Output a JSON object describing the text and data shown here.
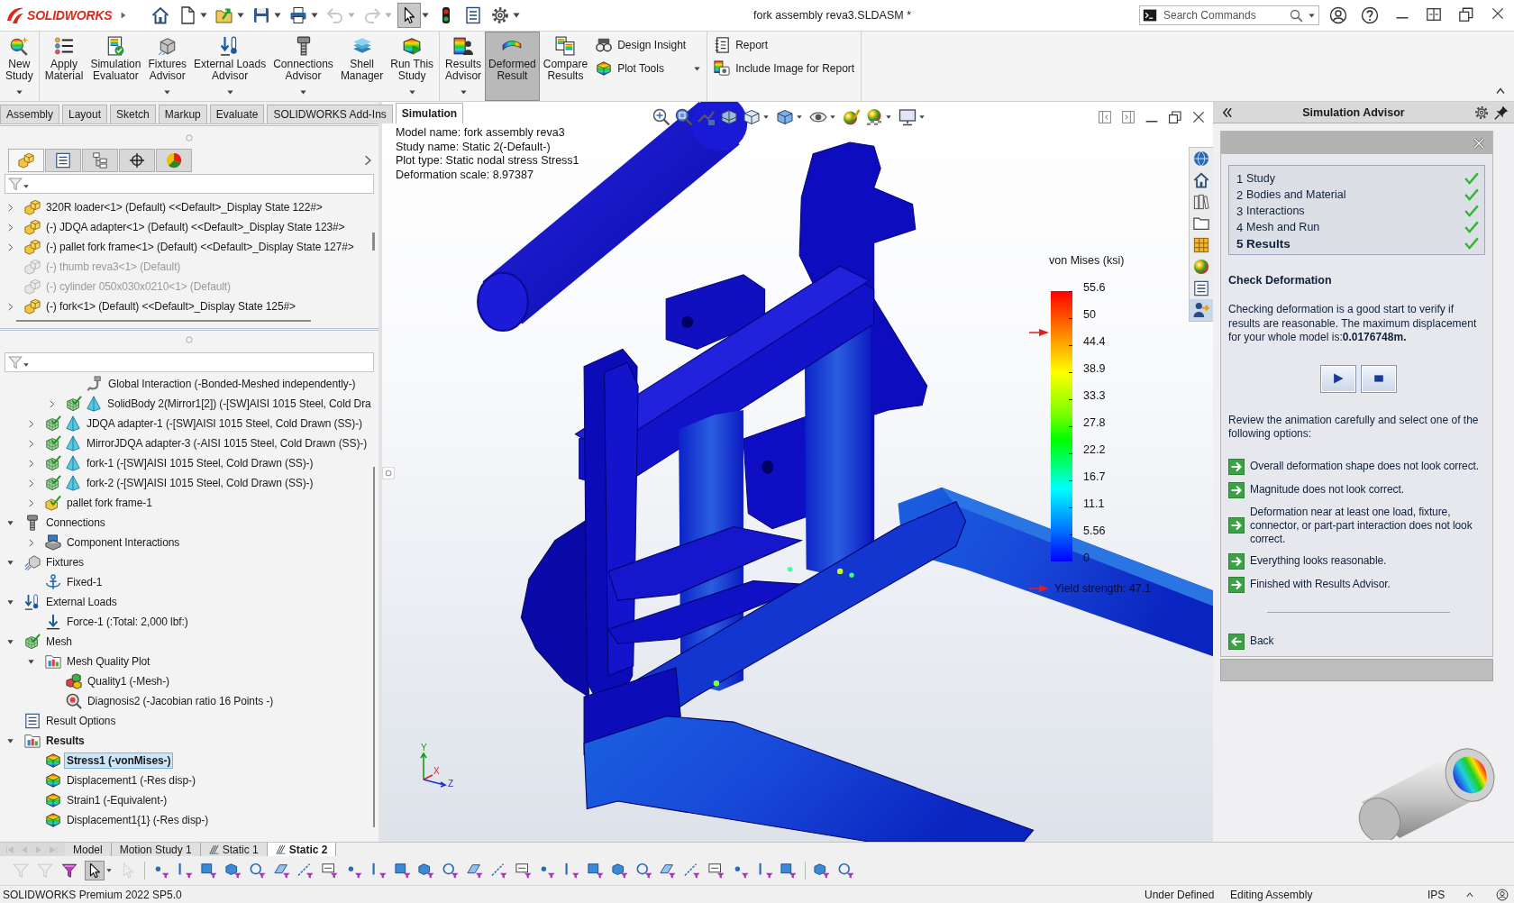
{
  "title_bar": {
    "logo": "SOLIDWORKS",
    "document_title": "fork assembly reva3.SLDASM *",
    "search": {
      "placeholder": "Search Commands"
    },
    "quick_access": [
      {
        "disabled": false,
        "selected": false
      },
      {
        "dropdown": true,
        "disabled": false,
        "selected": false
      },
      {
        "dropdown": true,
        "disabled": false,
        "selected": false
      },
      {
        "dropdown": true,
        "disabled": false,
        "selected": false
      },
      {
        "dropdown": true,
        "disabled": false,
        "selected": false
      },
      {
        "dropdown": true,
        "disabled": true,
        "selected": false
      },
      {
        "dropdown": true,
        "disabled": true,
        "selected": false
      },
      {
        "dropdown": true,
        "disabled": false,
        "selected": true
      },
      {
        "disabled": false,
        "selected": false
      },
      {
        "disabled": false,
        "selected": false
      },
      {
        "dropdown": true,
        "disabled": false,
        "selected": false
      }
    ]
  },
  "ribbon": {
    "groups": [
      {
        "items": [
          {
            "label": "New\nStudy",
            "kind": "large",
            "dropdown": true,
            "selected": false
          }
        ]
      },
      {
        "items": [
          {
            "label": "Apply\nMaterial",
            "kind": "large",
            "dropdown": false,
            "selected": false
          },
          {
            "label": "Simulation\nEvaluator",
            "kind": "large",
            "dropdown": false,
            "selected": false
          },
          {
            "label": "Fixtures\nAdvisor",
            "kind": "large",
            "dropdown": true,
            "selected": false
          },
          {
            "label": "External Loads\nAdvisor",
            "kind": "large",
            "dropdown": true,
            "selected": false
          },
          {
            "label": "Connections\nAdvisor",
            "kind": "large",
            "dropdown": true,
            "selected": false
          },
          {
            "label": "Shell\nManager",
            "kind": "large",
            "dropdown": false,
            "selected": false
          },
          {
            "label": "Run This\nStudy",
            "kind": "large",
            "dropdown": true,
            "selected": false
          }
        ]
      },
      {
        "items": [
          {
            "label": "Results\nAdvisor",
            "kind": "large",
            "dropdown": true,
            "selected": false
          },
          {
            "label": "Deformed\nResult",
            "kind": "large",
            "dropdown": false,
            "selected": true
          },
          {
            "label": "Compare\nResults",
            "kind": "large",
            "dropdown": false,
            "selected": false
          },
          {
            "label": "Design Insight",
            "kind": "small",
            "dropdown": false,
            "selected": false
          },
          {
            "label": "Plot Tools",
            "kind": "small",
            "dropdown": true,
            "selected": false
          }
        ]
      },
      {
        "items": [
          {
            "label": "Report",
            "kind": "small",
            "dropdown": false,
            "selected": false
          },
          {
            "label": "Include Image for Report",
            "kind": "small",
            "dropdown": false,
            "selected": false
          }
        ]
      }
    ]
  },
  "command_tabs": [
    {
      "label": "Assembly",
      "selected": false
    },
    {
      "label": "Layout",
      "selected": false
    },
    {
      "label": "Sketch",
      "selected": false
    },
    {
      "label": "Markup",
      "selected": false
    },
    {
      "label": "Evaluate",
      "selected": false
    },
    {
      "label": "SOLIDWORKS Add-Ins",
      "selected": false
    },
    {
      "label": "Simulation",
      "selected": true
    }
  ],
  "feature_manager": {
    "tabs": [
      {
        "selected": true
      },
      {
        "selected": false
      },
      {
        "selected": false
      },
      {
        "selected": false
      },
      {
        "selected": false
      }
    ],
    "upper_tree": [
      {
        "label": "320R loader<1> (Default) <<Default>_Display State 122#>",
        "expanded": false,
        "suppressed": false,
        "selected": false
      },
      {
        "label": "(-) JDQA adapter<1> (Default) <<Default>_Display State 123#>",
        "expanded": false,
        "suppressed": false,
        "selected": false
      },
      {
        "label": "(-) pallet fork frame<1> (Default) <<Default>_Display State 127#>",
        "expanded": false,
        "suppressed": false,
        "selected": false
      },
      {
        "label": "(-) thumb reva3<1> (Default)",
        "suppressed": true,
        "selected": false
      },
      {
        "label": "(-) cylinder 050x030x0210<1> (Default)",
        "suppressed": true,
        "selected": false
      },
      {
        "label": "(-) fork<1> (Default) <<Default>_Display State 125#>",
        "expanded": false,
        "suppressed": false,
        "selected": false
      }
    ],
    "lower_tree": [
      {
        "children": [
          {
            "children": [
              {
                "children": [
                  {
                    "label": "Global Interaction (-Bonded-Meshed independently-)",
                    "kind": "global-interaction",
                    "selected": false,
                    "active": false
                  }
                ]
              },
              {
                "label": "SolidBody 2(Mirror1[2]) (-[SW]AISI 1015 Steel, Cold Dra",
                "kind": "solid-body",
                "expanded": false,
                "selected": false,
                "active": false
              }
            ]
          },
          {
            "label": "JDQA adapter-1 (-[SW]AISI 1015 Steel, Cold Drawn (SS)-)",
            "kind": "solid-body",
            "expanded": false,
            "selected": false,
            "active": false
          },
          {
            "label": "MirrorJDQA adapter-3 (-AISI 1015 Steel, Cold Drawn (SS)-)",
            "kind": "solid-body",
            "expanded": false,
            "selected": false,
            "active": false
          },
          {
            "label": "fork-1 (-[SW]AISI 1015 Steel, Cold Drawn (SS)-)",
            "kind": "solid-body",
            "expanded": false,
            "selected": false,
            "active": false
          },
          {
            "label": "fork-2 (-[SW]AISI 1015 Steel, Cold Drawn (SS)-)",
            "kind": "solid-body",
            "expanded": false,
            "selected": false,
            "active": false
          },
          {
            "label": "pallet fork frame-1",
            "kind": "part",
            "expanded": false,
            "selected": false,
            "active": false
          }
        ]
      },
      {
        "label": "Connections",
        "kind": "connections",
        "expanded": true,
        "selected": false,
        "active": false,
        "children": [
          {
            "label": "Component Interactions",
            "kind": "component-interactions",
            "expanded": false,
            "selected": false,
            "active": false
          }
        ]
      },
      {
        "label": "Fixtures",
        "kind": "fixtures",
        "expanded": true,
        "selected": false,
        "active": false,
        "children": [
          {
            "label": "Fixed-1",
            "kind": "fixture",
            "selected": false,
            "active": false
          }
        ]
      },
      {
        "label": "External Loads",
        "kind": "external-loads",
        "expanded": true,
        "selected": false,
        "active": false,
        "children": [
          {
            "label": "Force-1 (:Total: 2,000 lbf:)",
            "kind": "force",
            "selected": false,
            "active": false
          }
        ]
      },
      {
        "label": "Mesh",
        "kind": "mesh",
        "expanded": true,
        "selected": false,
        "active": false,
        "children": [
          {
            "label": "Mesh Quality Plot",
            "kind": "plot-folder",
            "expanded": true,
            "selected": false,
            "active": false,
            "children": [
              {
                "label": "Quality1 (-Mesh-)",
                "kind": "mesh-plot",
                "selected": false,
                "active": false
              },
              {
                "label": "Diagnosis2 (-Jacobian ratio 16 Points -)",
                "kind": "diagnosis",
                "selected": false,
                "active": false
              }
            ]
          }
        ]
      },
      {
        "label": "Result Options",
        "kind": "result-options",
        "selected": false,
        "active": false
      },
      {
        "label": "Results",
        "kind": "results",
        "expanded": true,
        "selected": false,
        "active": true,
        "children": [
          {
            "label": "Stress1 (-vonMises-)",
            "kind": "result-plot",
            "selected": true,
            "active": true
          },
          {
            "label": "Displacement1 (-Res disp-)",
            "kind": "result-plot",
            "selected": false,
            "active": false
          },
          {
            "label": "Strain1 (-Equivalent-)",
            "kind": "result-plot",
            "selected": false,
            "active": false
          },
          {
            "label": "Displacement1{1} (-Res disp-)",
            "kind": "result-plot",
            "selected": false,
            "active": false
          }
        ]
      }
    ]
  },
  "graphics": {
    "plot_info": [
      "Model name: fork assembly reva3",
      "Study name: Static 2(-Default-)",
      "Plot type: Static nodal stress Stress1",
      "Deformation scale: 8.97387"
    ],
    "legend": {
      "title": "von Mises (ksi)",
      "ticks": [
        "55.6",
        "50",
        "44.4",
        "38.9",
        "33.3",
        "27.8",
        "22.2",
        "16.7",
        "11.1",
        "5.56",
        "0"
      ],
      "yield_marker": {
        "level": 0.847
      },
      "yield_label": "Yield strength: 47.1"
    },
    "triad": [
      "Y",
      "X",
      "Z"
    ],
    "task_pane_tabs": [
      {
        "selected": false
      },
      {
        "selected": false
      },
      {
        "selected": false
      },
      {
        "selected": false
      },
      {
        "selected": false
      },
      {
        "selected": false
      },
      {
        "selected": false
      },
      {
        "selected": true
      }
    ]
  },
  "simulation_advisor": {
    "title": "Simulation Advisor",
    "steps": [
      {
        "number": "1",
        "label": "Study",
        "done": true,
        "selected": false
      },
      {
        "number": "2",
        "label": "Bodies and Material",
        "done": true,
        "selected": false
      },
      {
        "number": "3",
        "label": "Interactions",
        "done": true,
        "selected": false
      },
      {
        "number": "4",
        "label": "Mesh and Run",
        "done": true,
        "selected": false
      },
      {
        "number": "5",
        "label": "Results",
        "done": true,
        "selected": true
      }
    ],
    "heading": "Check Deformation",
    "message": "Checking deformation is a good start to verify if results are reasonable. The maximum displacement for your whole model is:**0.0176748m.**",
    "prompt": "Review the animation carefully and select one of the following options:",
    "options": [
      "Overall deformation shape does not look correct.",
      "Magnitude does not look correct.",
      "Deformation near at least one load, fixture, connector, or part-part interaction does not look correct.",
      "Everything looks reasonable.",
      "Finished with Results Advisor."
    ],
    "back": "Back"
  },
  "bottom_tabs": {
    "nav_buttons": [
      {
        "disabled": true
      },
      {
        "disabled": true
      },
      {
        "disabled": true
      },
      {
        "disabled": true
      }
    ],
    "tabs": [
      {
        "label": "Model",
        "kind": "plain",
        "selected": false
      },
      {
        "label": "Motion Study 1",
        "kind": "plain",
        "selected": false
      },
      {
        "label": "Static 1",
        "kind": "study",
        "selected": false
      },
      {
        "label": "Static 2",
        "kind": "study",
        "selected": true
      }
    ]
  },
  "selection_toolbar": {
    "buttons": [
      {
        "disabled": true,
        "selected": false
      },
      {
        "disabled": true,
        "selected": false
      },
      {
        "disabled": false,
        "selected": false
      },
      {
        "disabled": false,
        "selected": true
      },
      {
        "disabled": true,
        "selected": false
      },
      {
        "disabled": false,
        "selected": false
      },
      {
        "disabled": false,
        "selected": false
      },
      {
        "disabled": false,
        "selected": false
      },
      {
        "disabled": false,
        "selected": false
      },
      {
        "disabled": false,
        "selected": false
      },
      {
        "disabled": false,
        "selected": false
      },
      {
        "disabled": false,
        "selected": false
      },
      {
        "disabled": false,
        "selected": false
      },
      {
        "disabled": false,
        "selected": false
      },
      {
        "disabled": false,
        "selected": false
      },
      {
        "disabled": false,
        "selected": false
      },
      {
        "disabled": false,
        "selected": false
      },
      {
        "disabled": false,
        "selected": false
      },
      {
        "disabled": false,
        "selected": false
      },
      {
        "disabled": false,
        "selected": false
      },
      {
        "disabled": false,
        "selected": false
      },
      {
        "disabled": false,
        "selected": false
      },
      {
        "disabled": false,
        "selected": false
      },
      {
        "disabled": false,
        "selected": false
      },
      {
        "disabled": false,
        "selected": false
      },
      {
        "disabled": false,
        "selected": false
      },
      {
        "disabled": false,
        "selected": false
      },
      {
        "disabled": false,
        "selected": false
      },
      {
        "disabled": false,
        "selected": false
      },
      {
        "disabled": false,
        "selected": false
      },
      {
        "disabled": false,
        "selected": false
      },
      {
        "disabled": false,
        "selected": false
      },
      {
        "disabled": false,
        "selected": false
      },
      {
        "disabled": false,
        "selected": false
      }
    ]
  },
  "status_bar": {
    "product": "SOLIDWORKS Premium 2022 SP5.0",
    "fields": [
      "Under Defined",
      "Editing Assembly",
      "IPS"
    ]
  }
}
